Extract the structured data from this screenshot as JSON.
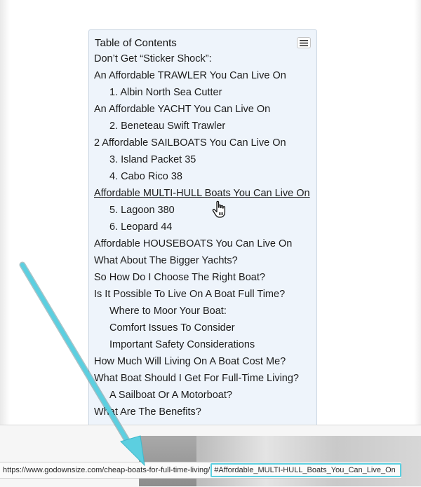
{
  "toc": {
    "title": "Table of Contents",
    "toggle_icon": "list-toggle-icon",
    "items": [
      {
        "label": "Don’t Get “Sticker Shock”:",
        "level": 1
      },
      {
        "label": "An Affordable TRAWLER You Can Live On",
        "level": 1
      },
      {
        "label": "1. Albin North Sea Cutter",
        "level": 2
      },
      {
        "label": "An Affordable YACHT You Can Live On",
        "level": 1
      },
      {
        "label": "2. Beneteau Swift Trawler",
        "level": 2
      },
      {
        "label": "2 Affordable SAILBOATS You Can Live On",
        "level": 1
      },
      {
        "label": "3. Island Packet 35",
        "level": 2
      },
      {
        "label": "4. Cabo Rico 38",
        "level": 2
      },
      {
        "label": "Affordable MULTI-HULL Boats You Can Live On",
        "level": 1,
        "hovered": true
      },
      {
        "label": "5. Lagoon 380",
        "level": 2
      },
      {
        "label": "6. Leopard 44",
        "level": 2
      },
      {
        "label": "Affordable HOUSEBOATS You Can Live On",
        "level": 1
      },
      {
        "label": "What About The Bigger Yachts?",
        "level": 1
      },
      {
        "label": "So How Do I Choose The Right Boat?",
        "level": 1
      },
      {
        "label": "Is It Possible To Live On A Boat Full Time?",
        "level": 1
      },
      {
        "label": "Where to Moor Your Boat:",
        "level": 2
      },
      {
        "label": "Comfort Issues To Consider",
        "level": 2
      },
      {
        "label": "Important Safety Considerations",
        "level": 2
      },
      {
        "label": "How Much Will Living On A Boat Cost Me?",
        "level": 1
      },
      {
        "label": "What Boat Should I Get For Full-Time Living?",
        "level": 1
      },
      {
        "label": "A Sailboat Or A Motorboat?",
        "level": 2
      },
      {
        "label": "What Are The Benefits?",
        "level": 1
      }
    ]
  },
  "status_bar": {
    "url_base": "https://www.godownsize.com/cheap-boats-for-full-time-living/",
    "url_hash": "#Affordable_MULTI-HULL_Boats_You_Can_Live_On"
  },
  "colors": {
    "toc_background": "#eef4fb",
    "annotation_arrow": "#5ccfe0"
  },
  "icons": {
    "cursor": "hand-pointer-icon",
    "arrow": "annotation-arrow-icon"
  }
}
